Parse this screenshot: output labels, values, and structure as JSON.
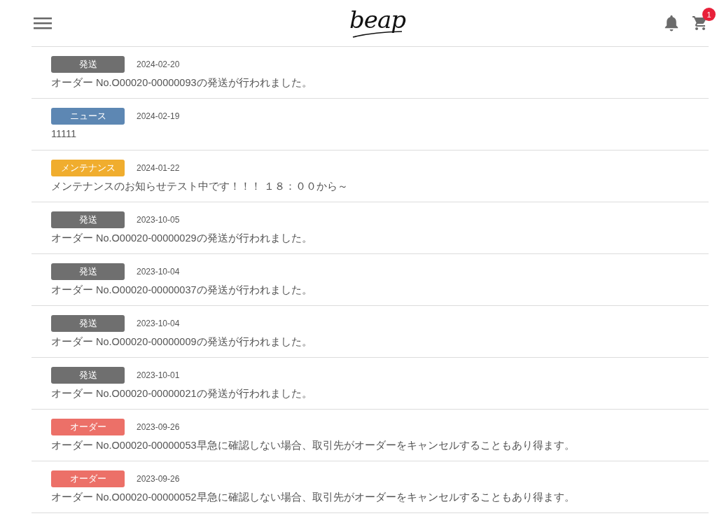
{
  "header": {
    "logo": "beap",
    "cart_count": "1"
  },
  "notices": [
    {
      "tag": "発送",
      "color": "#6f6f6f",
      "date": "2024-02-20",
      "message": "オーダー No.O00020-00000093の発送が行われました。"
    },
    {
      "tag": "ニュース",
      "color": "#5d87b3",
      "date": "2024-02-19",
      "message": "11111"
    },
    {
      "tag": "メンテナンス",
      "color": "#f0ad2e",
      "date": "2024-01-22",
      "message": "メンテナンスのお知らせテスト中です！！！ １８：００から～"
    },
    {
      "tag": "発送",
      "color": "#6f6f6f",
      "date": "2023-10-05",
      "message": "オーダー No.O00020-00000029の発送が行われました。"
    },
    {
      "tag": "発送",
      "color": "#6f6f6f",
      "date": "2023-10-04",
      "message": "オーダー No.O00020-00000037の発送が行われました。"
    },
    {
      "tag": "発送",
      "color": "#6f6f6f",
      "date": "2023-10-04",
      "message": "オーダー No.O00020-00000009の発送が行われました。"
    },
    {
      "tag": "発送",
      "color": "#6f6f6f",
      "date": "2023-10-01",
      "message": "オーダー No.O00020-00000021の発送が行われました。"
    },
    {
      "tag": "オーダー",
      "color": "#ec7068",
      "date": "2023-09-26",
      "message": "オーダー No.O00020-00000053早急に確認しない場合、取引先がオーダーをキャンセルすることもあり得ます。"
    },
    {
      "tag": "オーダー",
      "color": "#ec7068",
      "date": "2023-09-26",
      "message": "オーダー No.O00020-00000052早急に確認しない場合、取引先がオーダーをキャンセルすることもあり得ます。"
    }
  ]
}
